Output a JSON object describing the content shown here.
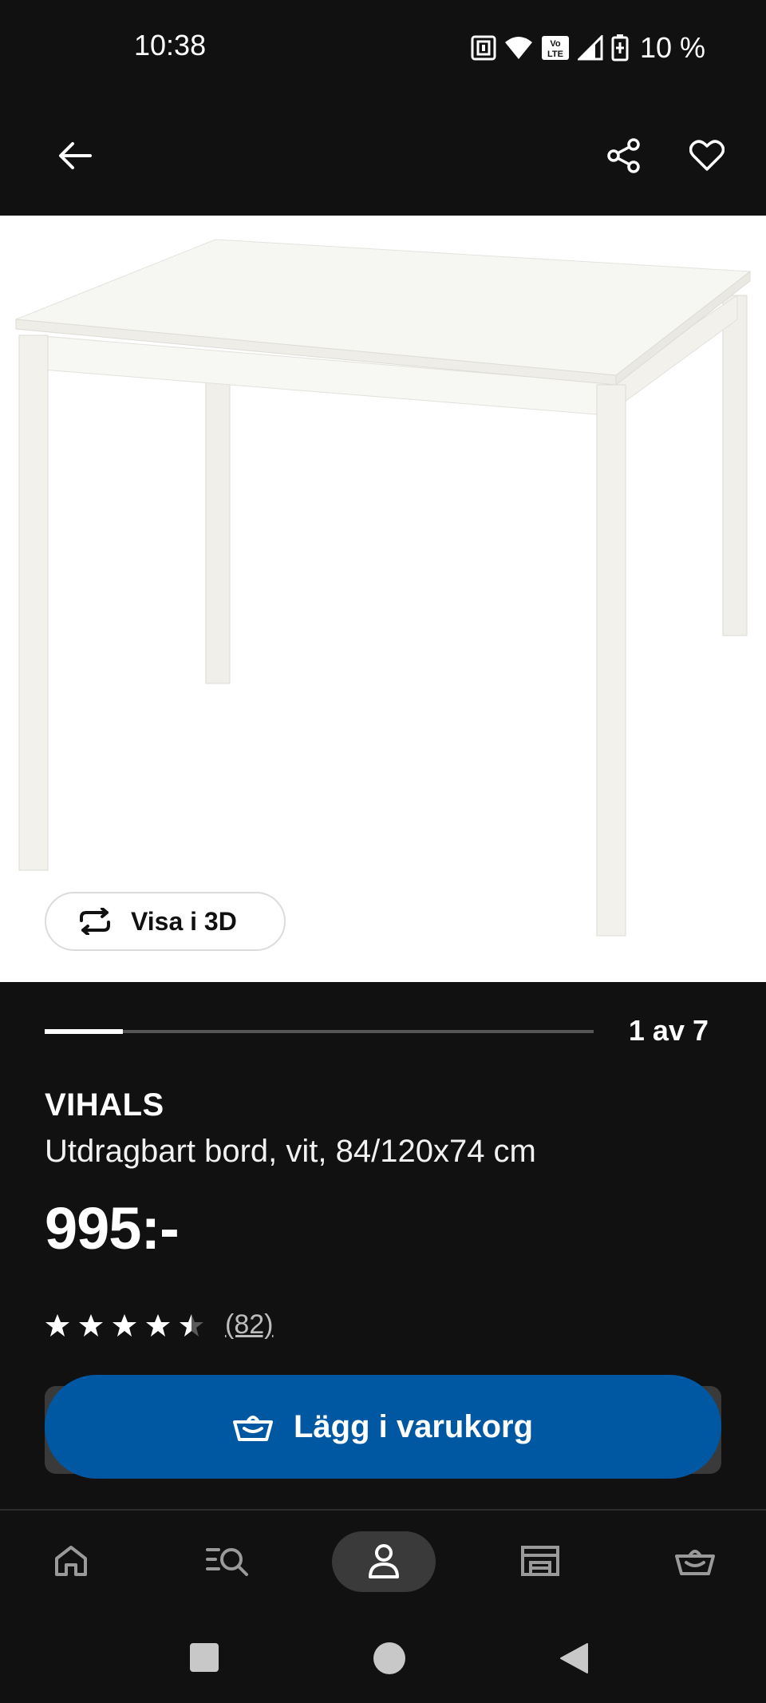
{
  "status_bar": {
    "time": "10:38",
    "battery": "10 %",
    "icons": [
      "nfc-icon",
      "wifi-icon",
      "volte-icon",
      "signal-icon",
      "battery-icon"
    ]
  },
  "app_bar": {
    "icons": [
      "back-arrow-icon",
      "share-icon",
      "heart-icon"
    ]
  },
  "gallery": {
    "view_3d_label": "Visa i 3D",
    "page_indicator": "1 av 7",
    "current_index": 1,
    "total_images": 7
  },
  "product": {
    "name": "VIHALS",
    "description": "Utdragbart bord, vit, 84/120x74 cm",
    "price": "995:-",
    "rating": 4.5,
    "rating_max": 5,
    "review_count": "(82)"
  },
  "cta": {
    "label": "Lägg i varukorg",
    "color": "#0058a3",
    "icon": "basket-icon"
  },
  "bottom_nav": {
    "items": [
      "home-icon",
      "search-list-icon",
      "profile-icon",
      "store-icon",
      "basket-icon"
    ],
    "active": "profile-icon"
  },
  "system_nav": {
    "icons": [
      "recents-icon",
      "home-circle-icon",
      "back-triangle-icon"
    ]
  },
  "colors": {
    "background": "#111111",
    "accent_blue": "#0058a3",
    "image_bg": "#ffffff"
  }
}
